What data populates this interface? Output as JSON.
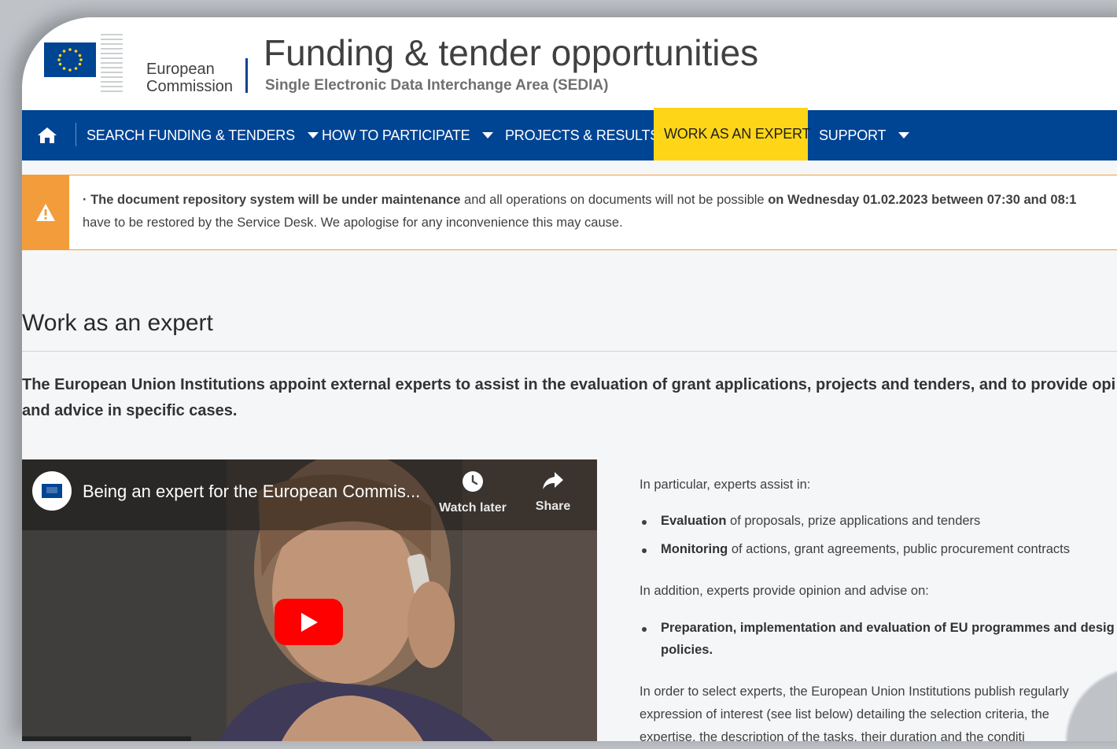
{
  "header": {
    "logo_line1": "European",
    "logo_line2": "Commission",
    "title": "Funding & tender opportunities",
    "subtitle": "Single Electronic Data Interchange Area (SEDIA)"
  },
  "nav": {
    "items": [
      {
        "label": "SEARCH FUNDING & TENDERS",
        "dropdown": true
      },
      {
        "label": "HOW TO PARTICIPATE",
        "dropdown": true
      },
      {
        "label": "PROJECTS & RESULTS",
        "dropdown": false
      },
      {
        "label": "WORK AS AN EXPERT",
        "dropdown": false,
        "active": true
      },
      {
        "label": "SUPPORT",
        "dropdown": true
      }
    ]
  },
  "alert": {
    "bold1": "· The document repository system will be under maintenance",
    "text1": " and all operations on documents will not be possible ",
    "bold2": "on Wednesday 01.02.2023 between 07:30 and 08:1",
    "line2": "have to be restored by the Service Desk. We apologise for any inconvenience this may cause."
  },
  "page": {
    "title": "Work as an expert",
    "intro_line1": "The European Union Institutions appoint external experts to assist in the evaluation of grant applications, projects and tenders, and to provide opi",
    "intro_line2": "and advice in specific cases."
  },
  "video": {
    "title": "Being an expert for the European Commis...",
    "watch_later": "Watch later",
    "share": "Share"
  },
  "content": {
    "p1": "In particular, experts assist in:",
    "b1_bold": "Evaluation",
    "b1_rest": " of proposals, prize applications and tenders",
    "b2_bold": "Monitoring",
    "b2_rest": " of actions, grant agreements, public procurement contracts",
    "p2": "In addition, experts provide opinion and advise on:",
    "b3_line1": "Preparation, implementation and evaluation of EU programmes and desig",
    "b3_line2": "policies.",
    "p3_line1": "In order to select experts, the European Union Institutions publish regularly",
    "p3_line2": "expression of interest (see list below) detailing the selection criteria, the",
    "p3_line3": "expertise, the description of the tasks, their duration and the conditi"
  },
  "colors": {
    "navy": "#004494",
    "active_yellow": "#ffd617",
    "alert_orange": "#f39c3b",
    "play_red": "#ff0000"
  }
}
